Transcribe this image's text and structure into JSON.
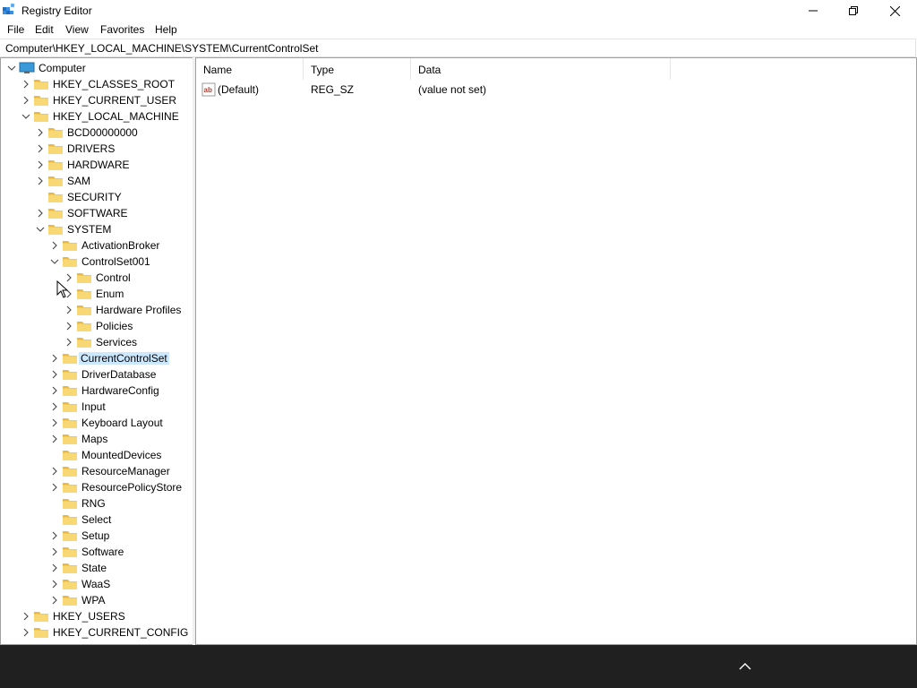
{
  "window": {
    "title": "Registry Editor"
  },
  "menu": {
    "file": "File",
    "edit": "Edit",
    "view": "View",
    "favorites": "Favorites",
    "help": "Help"
  },
  "address": {
    "path": "Computer\\HKEY_LOCAL_MACHINE\\SYSTEM\\CurrentControlSet"
  },
  "tree": {
    "computer": "Computer",
    "hkcr": "HKEY_CLASSES_ROOT",
    "hkcu": "HKEY_CURRENT_USER",
    "hklm": "HKEY_LOCAL_MACHINE",
    "bcd": "BCD00000000",
    "drivers": "DRIVERS",
    "hardware": "HARDWARE",
    "sam": "SAM",
    "security": "SECURITY",
    "software": "SOFTWARE",
    "system": "SYSTEM",
    "activationbroker": "ActivationBroker",
    "controlset001": "ControlSet001",
    "control": "Control",
    "enum": "Enum",
    "hardwareprofiles": "Hardware Profiles",
    "policies": "Policies",
    "services": "Services",
    "currentcontrolset": "CurrentControlSet",
    "driverdatabase": "DriverDatabase",
    "hardwareconfig": "HardwareConfig",
    "input": "Input",
    "keyboardlayout": "Keyboard Layout",
    "maps": "Maps",
    "mounteddevices": "MountedDevices",
    "resourcemanager": "ResourceManager",
    "resourcepolicystore": "ResourcePolicyStore",
    "rng": "RNG",
    "select": "Select",
    "setup": "Setup",
    "software2": "Software",
    "state": "State",
    "waas": "WaaS",
    "wpa": "WPA",
    "hku": "HKEY_USERS",
    "hkcc": "HKEY_CURRENT_CONFIG"
  },
  "list": {
    "columns": {
      "name": "Name",
      "type": "Type",
      "data": "Data"
    },
    "rows": [
      {
        "name": "(Default)",
        "type": "REG_SZ",
        "data": "(value not set)"
      }
    ]
  },
  "colors": {
    "selection": "#cce8ff",
    "folder": "#f8d775",
    "taskbar": "#202020"
  }
}
